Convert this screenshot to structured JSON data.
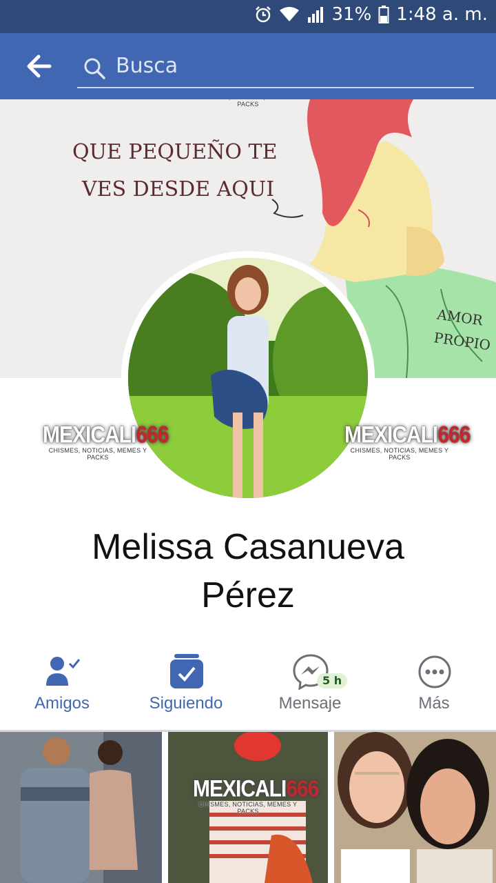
{
  "status": {
    "battery": "31%",
    "time": "1:48 a. m."
  },
  "search": {
    "placeholder": "Busca"
  },
  "watermark": {
    "brand": "MEXICALI",
    "number": "666",
    "tagline": "CHISMES, NOTICIAS, MEMES Y PACKS"
  },
  "cover": {
    "line1": "QUE PEQUEÑO TE",
    "line2": "VES DESDE AQUI",
    "tag1": "AMOR",
    "tag2": "PROPIO"
  },
  "profile": {
    "name_line1": "Melissa Casanueva",
    "name_line2": "Pérez"
  },
  "actions": [
    {
      "label": "Amigos",
      "icon": "friends-check-icon"
    },
    {
      "label": "Siguiendo",
      "icon": "following-check-icon"
    },
    {
      "label": "Mensaje",
      "icon": "messenger-icon",
      "badge": "5 h"
    },
    {
      "label": "Más",
      "icon": "more-dots-icon"
    }
  ],
  "colors": {
    "statusbar": "#2f4a78",
    "appbar": "#4267b2",
    "accent": "#4267b2",
    "muted": "#6b6f76"
  }
}
